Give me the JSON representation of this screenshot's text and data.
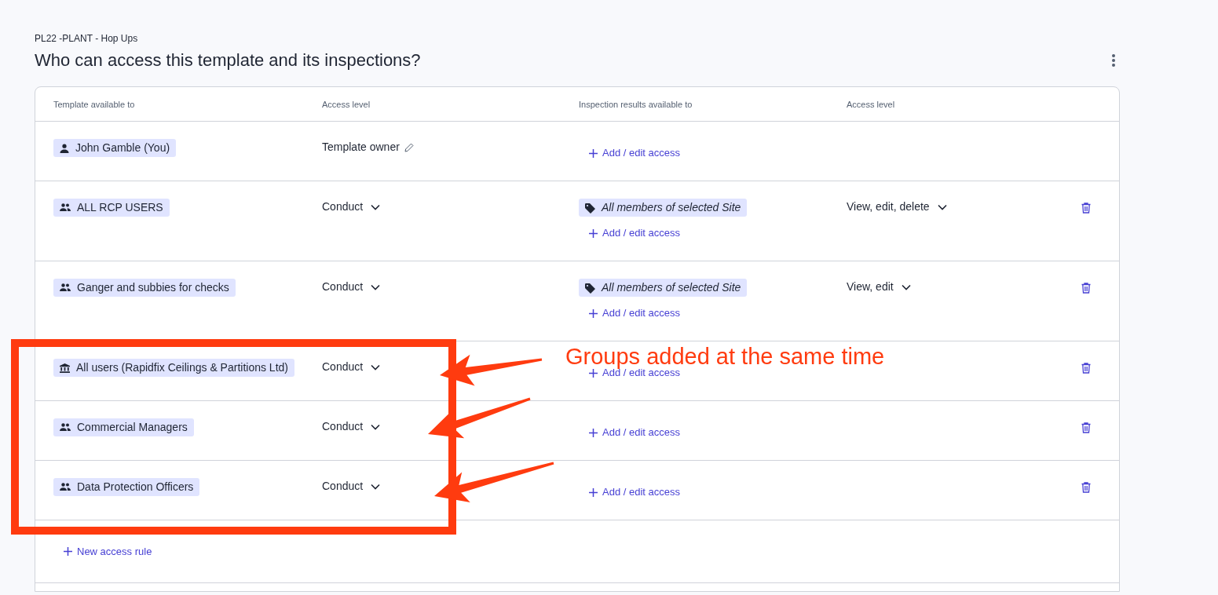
{
  "breadcrumb": "PL22 -PLANT - Hop Ups",
  "title": "Who can access this template and its inspections?",
  "columns": [
    "Template available to",
    "Access level",
    "Inspection results available to",
    "Access level"
  ],
  "rules": [
    {
      "principal": {
        "kind": "user",
        "label": "John Gamble (You)"
      },
      "access": {
        "kind": "owner",
        "label": "Template owner"
      },
      "add_access": "Add / edit access",
      "deletable": false
    },
    {
      "principal": {
        "kind": "group",
        "label": "ALL RCP USERS"
      },
      "access": {
        "kind": "dropdown",
        "label": "Conduct"
      },
      "results": [
        {
          "label": "All members of selected Site"
        }
      ],
      "results_access": "View, edit, delete",
      "add_access": "Add / edit access",
      "deletable": true
    },
    {
      "principal": {
        "kind": "group",
        "label": "Ganger and subbies for checks"
      },
      "access": {
        "kind": "dropdown",
        "label": "Conduct"
      },
      "results": [
        {
          "label": "All members of selected Site"
        }
      ],
      "results_access": "View, edit",
      "add_access": "Add / edit access",
      "deletable": true
    },
    {
      "principal": {
        "kind": "organization",
        "label": "All users (Rapidfix Ceilings & Partitions Ltd)"
      },
      "access": {
        "kind": "dropdown",
        "label": "Conduct"
      },
      "add_access": "Add / edit access",
      "deletable": true
    },
    {
      "principal": {
        "kind": "group",
        "label": "Commercial Managers"
      },
      "access": {
        "kind": "dropdown",
        "label": "Conduct"
      },
      "add_access": "Add / edit access",
      "deletable": true
    },
    {
      "principal": {
        "kind": "group",
        "label": "Data Protection Officers"
      },
      "access": {
        "kind": "dropdown",
        "label": "Conduct"
      },
      "add_access": "Add / edit access",
      "deletable": true
    }
  ],
  "new_rule": "New access rule",
  "annotation": {
    "text": "Groups added at the same time"
  }
}
